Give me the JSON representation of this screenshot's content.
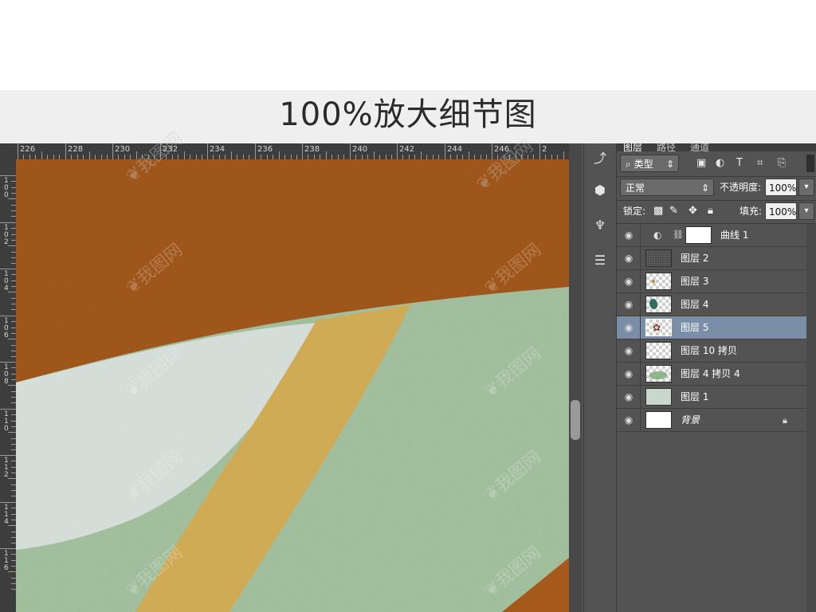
{
  "banner": {
    "title": "100%放大细节图"
  },
  "ruler": {
    "top_labels": [
      "226",
      "228",
      "230",
      "232",
      "234",
      "236",
      "238",
      "240",
      "242",
      "244",
      "246",
      "2"
    ],
    "left_labels": [
      "100",
      "102",
      "104",
      "106",
      "108",
      "110",
      "112",
      "114",
      "116"
    ]
  },
  "tools": [
    {
      "icon": "history-icon",
      "glyph": "⤴"
    },
    {
      "icon": "3d-icon",
      "glyph": "⬢"
    },
    {
      "icon": "brush-presets-icon",
      "glyph": "♆"
    },
    {
      "icon": "properties-icon",
      "glyph": "☰"
    }
  ],
  "panel": {
    "tabs": [
      "图层",
      "路径",
      "通道"
    ],
    "filter_kind": "类型",
    "filter_icons": [
      "image-filter-icon",
      "adjustment-filter-icon",
      "type-filter-icon",
      "shape-filter-icon",
      "smart-object-filter-icon"
    ],
    "blend_mode": "正常",
    "opacity_label": "不透明度:",
    "opacity_value": "100%",
    "lock_label": "锁定:",
    "fill_label": "填充:",
    "fill_value": "100%",
    "layers": [
      {
        "name": "曲线 1",
        "thumb": "white",
        "adjustment": true,
        "selected": false
      },
      {
        "name": "图层 2",
        "thumb": "dark",
        "selected": false
      },
      {
        "name": "图层 3",
        "thumb": "checker-dot",
        "selected": false
      },
      {
        "name": "图层 4",
        "thumb": "checker-teal",
        "selected": false
      },
      {
        "name": "图层 5",
        "thumb": "checker-branch",
        "selected": true
      },
      {
        "name": "图层 10 拷贝",
        "thumb": "checker",
        "selected": false
      },
      {
        "name": "图层 4 拷贝 4",
        "thumb": "checker-green",
        "selected": false
      },
      {
        "name": "图层 1",
        "thumb": "pale-green",
        "selected": false
      },
      {
        "name": "背景",
        "thumb": "white",
        "selected": false,
        "locked": true
      }
    ]
  },
  "colors": {
    "brown": "#a55a1b",
    "pale_blue": "#dde6e1",
    "gold": "#d8b25a",
    "sage": "#a8c6a3",
    "selected_row": "#7b8ea8"
  }
}
